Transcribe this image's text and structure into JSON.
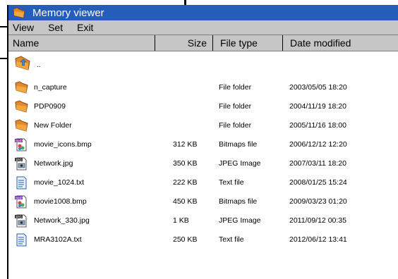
{
  "window": {
    "title": "Memory viewer"
  },
  "menu": [
    {
      "label": "View"
    },
    {
      "label": "Set"
    },
    {
      "label": "Exit"
    }
  ],
  "columns": {
    "name": "Name",
    "size": "Size",
    "type": "File type",
    "date": "Date modified"
  },
  "up_entry": {
    "label": "..",
    "icon": "folder-up-icon"
  },
  "files": [
    {
      "name": "n_capture",
      "size": "",
      "type": "File folder",
      "date": "2003/05/05 18:20",
      "icon": "folder-icon"
    },
    {
      "name": "PDP0909",
      "size": "",
      "type": "File folder",
      "date": "2004/11/19 18:20",
      "icon": "folder-icon"
    },
    {
      "name": "New Folder",
      "size": "",
      "type": "File folder",
      "date": "2005/11/16 18:00",
      "icon": "folder-icon"
    },
    {
      "name": "movie_icons.bmp",
      "size": "312 KB",
      "type": "Bitmaps file",
      "date": "2006/12/12 12:20",
      "icon": "bmp-file-icon"
    },
    {
      "name": "Network.jpg",
      "size": "350 KB",
      "type": "JPEG Image",
      "date": "2007/03/11 18:20",
      "icon": "jpg-file-icon"
    },
    {
      "name": "movie_1024.txt",
      "size": "222 KB",
      "type": "Text file",
      "date": "2008/01/25 15:24",
      "icon": "txt-file-icon"
    },
    {
      "name": "movie1008.bmp",
      "size": "450 KB",
      "type": "Bitmaps file",
      "date": "2009/03/23 01:20",
      "icon": "bmp-file-icon"
    },
    {
      "name": "Network_330.jpg",
      "size": "1 KB",
      "type": "JPEG Image",
      "date": "2011/09/12 00:35",
      "icon": "jpg-file-icon"
    },
    {
      "name": "MRA3102A.txt",
      "size": "250 KB",
      "type": "Text file",
      "date": "2012/06/12 13:41",
      "icon": "txt-file-icon"
    }
  ],
  "colors": {
    "titlebar": "#245dba",
    "bars": "#c6c6c6",
    "folder": "#e08a2c"
  }
}
